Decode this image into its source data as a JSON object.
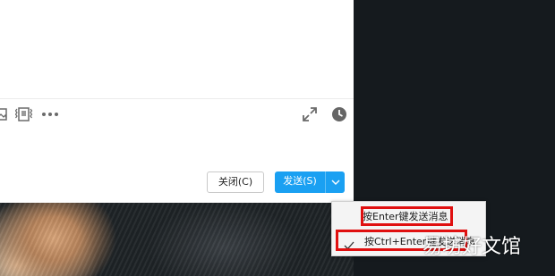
{
  "compose": {
    "toolbar_icons": [
      "image-icon",
      "screenshot-icon",
      "more-icon",
      "expand-icon",
      "history-icon"
    ],
    "close_label": "关闭(C)",
    "send_label": "发送(S)"
  },
  "send_menu": {
    "items": [
      {
        "label": "按Enter键发送消息",
        "checked": false
      },
      {
        "label": "按Ctrl+Enter键发送消息",
        "checked": true
      }
    ]
  },
  "watermark": {
    "text": "易坊好文馆"
  },
  "colors": {
    "primary": "#1aa0f2",
    "highlight": "#e01010",
    "menu_bg": "#f4f4f4",
    "backdrop": "#151a1e"
  }
}
